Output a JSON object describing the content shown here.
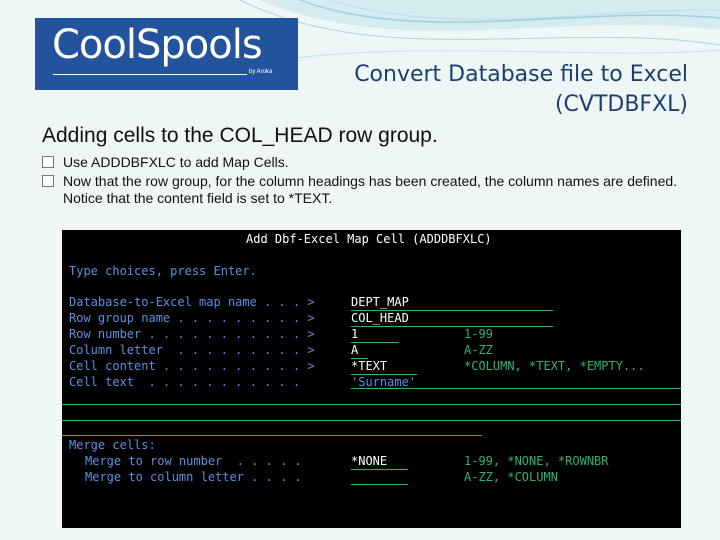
{
  "logo": {
    "text": "CoolSpools",
    "byline": "by Aroka"
  },
  "slide": {
    "title_line1": "Convert Database file to Excel",
    "title_line2": "(CVTDBFXL)",
    "heading": "Adding cells to the COL_HEAD row group.",
    "bullets": [
      "Use ADDDBFXLC to add Map Cells.",
      "Now that the row group, for the column headings has been created, the column names are defined.  Notice that the content field is set to *TEXT."
    ]
  },
  "terminal": {
    "title": "Add Dbf-Excel Map Cell (ADDDBFXLC)",
    "prompt": "Type choices, press Enter.",
    "fields": [
      {
        "label": "Database-to-Excel map name . . . >",
        "value": "DEPT_MAP",
        "hint": ""
      },
      {
        "label": "Row group name . . . . . . . . . >",
        "value": "COL_HEAD",
        "hint": ""
      },
      {
        "label": "Row number . . . . . . . . . . . >",
        "value": "1",
        "hint": "1-99"
      },
      {
        "label": "Column letter  . . . . . . . . . >",
        "value": "A",
        "hint": "A-ZZ"
      },
      {
        "label": "Cell content . . . . . . . . . . >",
        "value": "*TEXT",
        "hint": "*COLUMN, *TEXT, *EMPTY..."
      },
      {
        "label": "Cell text  . . . . . . . . . . .  ",
        "value": "'Surname'",
        "hint": ""
      }
    ],
    "merge_heading": "Merge cells:",
    "merge_fields": [
      {
        "label": "Merge to row number  . . . . .",
        "value": "*NONE",
        "hint": "1-99, *NONE, *ROWNBR"
      },
      {
        "label": "Merge to column letter . . . .",
        "value": "",
        "hint": "A-ZZ, *COLUMN"
      }
    ]
  },
  "colors": {
    "terminal_bg": "#000000",
    "terminal_green": "#2fb36a",
    "terminal_blue": "#5b8fe0",
    "logo_bg": "#24539d"
  }
}
